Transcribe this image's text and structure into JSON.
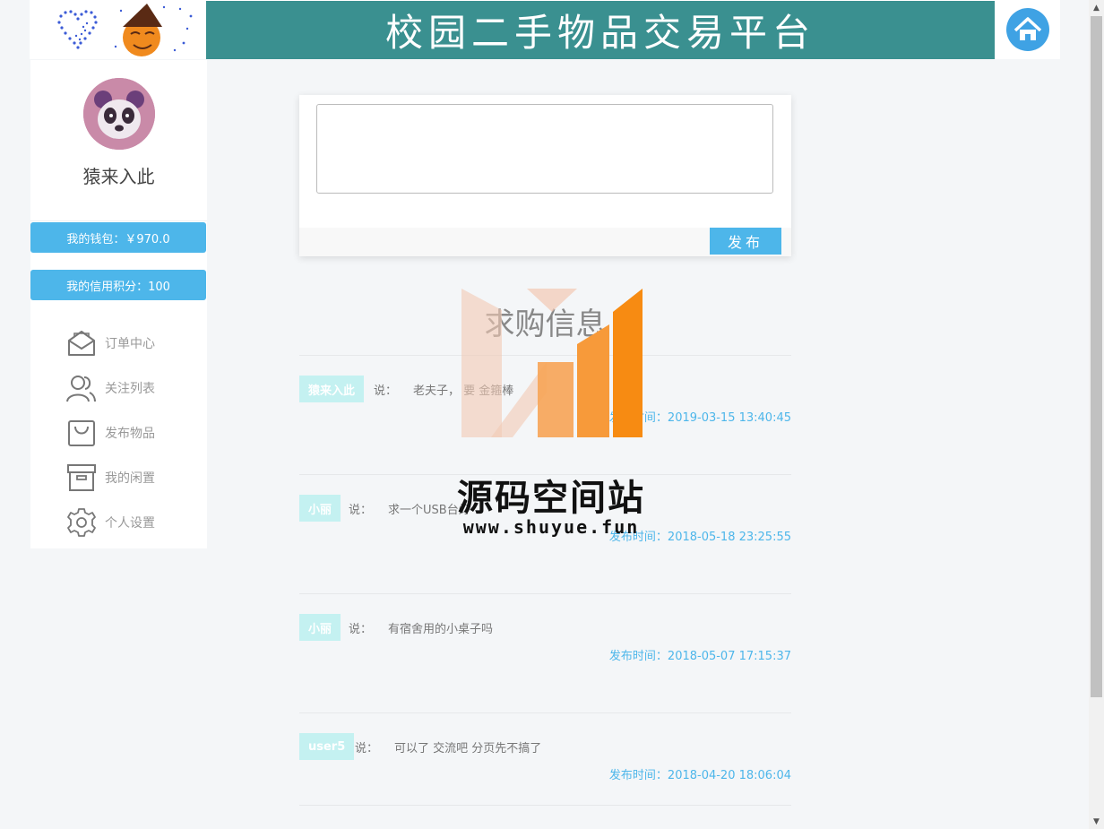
{
  "header": {
    "title": "校园二手物品交易平台"
  },
  "sidebar": {
    "username": "猿来入此",
    "wallet": "我的钱包：￥970.0",
    "credit": "我的信用积分：100",
    "menu": [
      {
        "label": "订单中心",
        "icon": "envelope-icon"
      },
      {
        "label": "关注列表",
        "icon": "users-icon"
      },
      {
        "label": "发布物品",
        "icon": "bag-icon"
      },
      {
        "label": "我的闲置",
        "icon": "archive-icon"
      },
      {
        "label": "个人设置",
        "icon": "gear-icon"
      }
    ]
  },
  "post": {
    "button": "发布",
    "placeholder": ""
  },
  "section_title": "求购信息",
  "requests": [
    {
      "user": "猿来入此",
      "say": "说：",
      "content": "老夫子，    要     金箍棒",
      "time": "发布时间：2019-03-15 13:40:45"
    },
    {
      "user": "小丽",
      "say": "说：",
      "content": "求一个USB台灯",
      "time": "发布时间：2018-05-18 23:25:55"
    },
    {
      "user": "小丽",
      "say": "说：",
      "content": "有宿舍用的小桌子吗",
      "time": "发布时间：2018-05-07 17:15:37"
    },
    {
      "user": "user5",
      "say": "说：",
      "content": "可以了 交流吧 分页先不搞了",
      "time": "发布时间：2018-04-20 18:06:04"
    }
  ],
  "watermark": {
    "title": "源码空间站",
    "url": "www.shuyue.fun",
    "colors": [
      "#f2c9b4",
      "#f7a455",
      "#f78b12"
    ]
  },
  "colors": {
    "accent": "#4db6ea",
    "banner": "#3a9090",
    "user_tag": "#c4f1f1"
  }
}
